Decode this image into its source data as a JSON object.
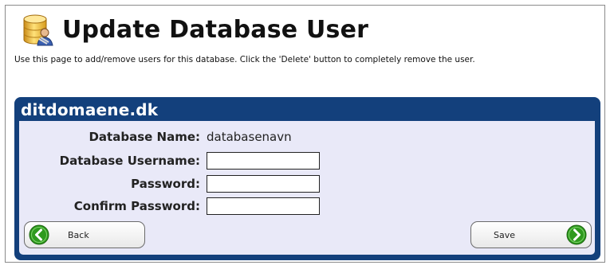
{
  "page": {
    "title": "Update Database User",
    "description": "Use this page to add/remove users for this database. Click the 'Delete' button to completely remove the user."
  },
  "panel": {
    "title": "ditdomaene.dk",
    "fields": {
      "database_name_label": "Database Name:",
      "database_name_value": "databasenavn",
      "username_label": "Database Username:",
      "username_value": "",
      "password_label": "Password:",
      "password_value": "",
      "confirm_password_label": "Confirm Password:",
      "confirm_password_value": ""
    },
    "buttons": {
      "back_label": "Back",
      "save_label": "Save"
    }
  },
  "colors": {
    "panel_header": "#13407c",
    "panel_body": "#e9e9f8",
    "icon_green": "#2e9a1e"
  },
  "icons": [
    "database-user-icon",
    "arrow-left-icon",
    "arrow-right-icon"
  ]
}
